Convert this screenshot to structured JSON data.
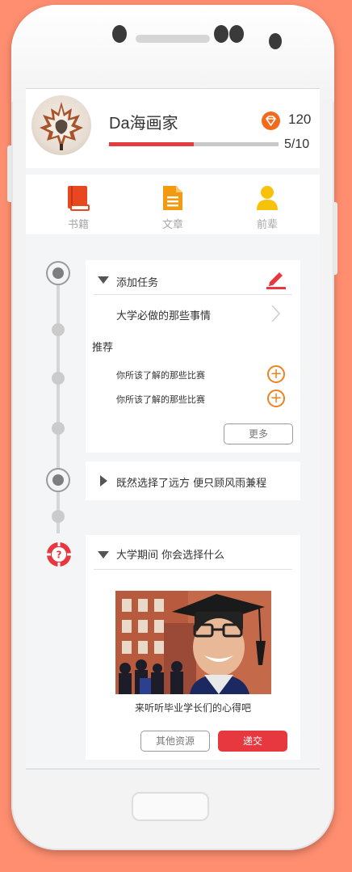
{
  "profile": {
    "username": "Da海画家",
    "score": "120",
    "progress": 0.5,
    "progress_text": "5/10"
  },
  "nav": [
    {
      "label": "书籍",
      "icon": "book-icon"
    },
    {
      "label": "文章",
      "icon": "document-icon"
    },
    {
      "label": "前辈",
      "icon": "person-icon"
    }
  ],
  "task_card": {
    "title": "添加任务",
    "edit_icon": "pencil-icon",
    "item": "大学必做的那些事情",
    "recommend_label": "推荐",
    "recommendations": [
      "你所该了解的那些比赛",
      "你所该了解的那些比赛"
    ],
    "more_label": "更多"
  },
  "collapsed_card": {
    "title": "既然选择了远方 便只顾风雨兼程"
  },
  "question_card": {
    "title": "大学期间 你会选择什么",
    "caption": "来听听毕业学长们的心得吧",
    "other_label": "其他资源",
    "submit_label": "递交"
  },
  "colors": {
    "accent": "#e6383e",
    "orange": "#f0821d",
    "background": "#ff8e70"
  }
}
